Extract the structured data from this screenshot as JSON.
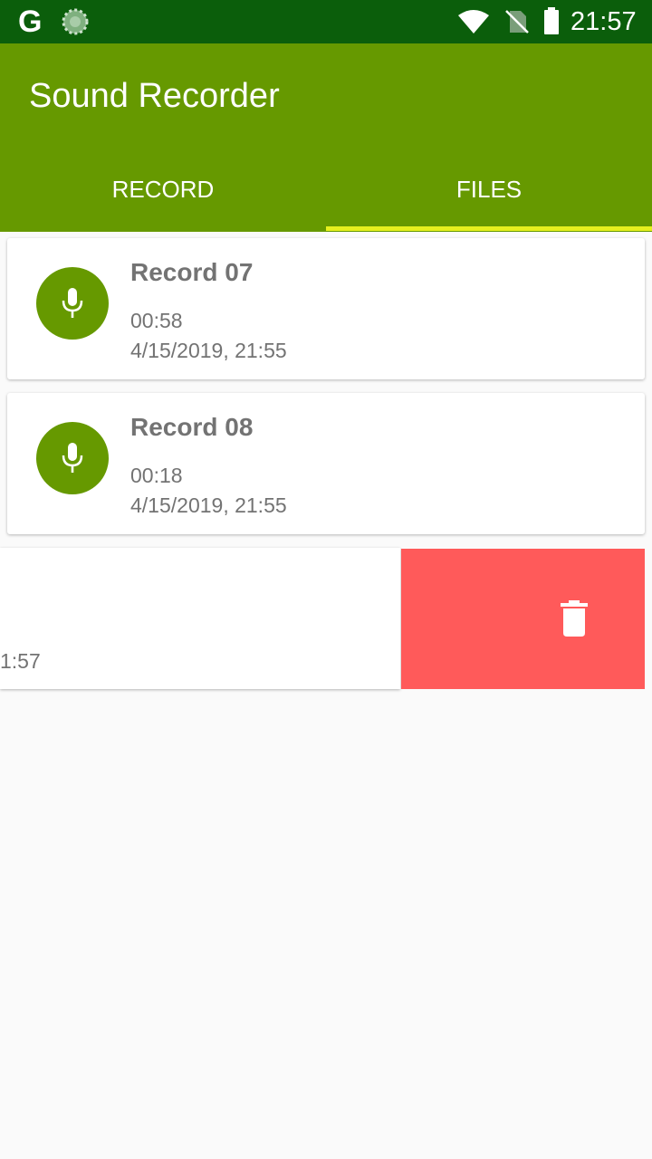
{
  "status_bar": {
    "g_letter": "G",
    "clock": "21:57",
    "icons": [
      "google-icon",
      "loading-icon",
      "wifi-icon",
      "no-sim-icon",
      "battery-icon"
    ]
  },
  "app": {
    "title": "Sound Recorder",
    "tabs": [
      {
        "label": "RECORD",
        "selected": false
      },
      {
        "label": "FILES",
        "selected": true
      }
    ]
  },
  "recordings": [
    {
      "name": "Record 07",
      "duration": "00:58",
      "date": "4/15/2019, 21:55"
    },
    {
      "name": "Record 08",
      "duration": "00:18",
      "date": "4/15/2019, 21:55"
    }
  ],
  "swiped_item": {
    "visible_text": "1:57",
    "action_icon": "trash-icon"
  },
  "colors": {
    "status_bar": "#0b5e0b",
    "primary": "#669900",
    "tab_indicator": "#e6f01e",
    "delete": "#ff5a5a",
    "background": "#fafafa",
    "text_secondary": "#737373"
  }
}
